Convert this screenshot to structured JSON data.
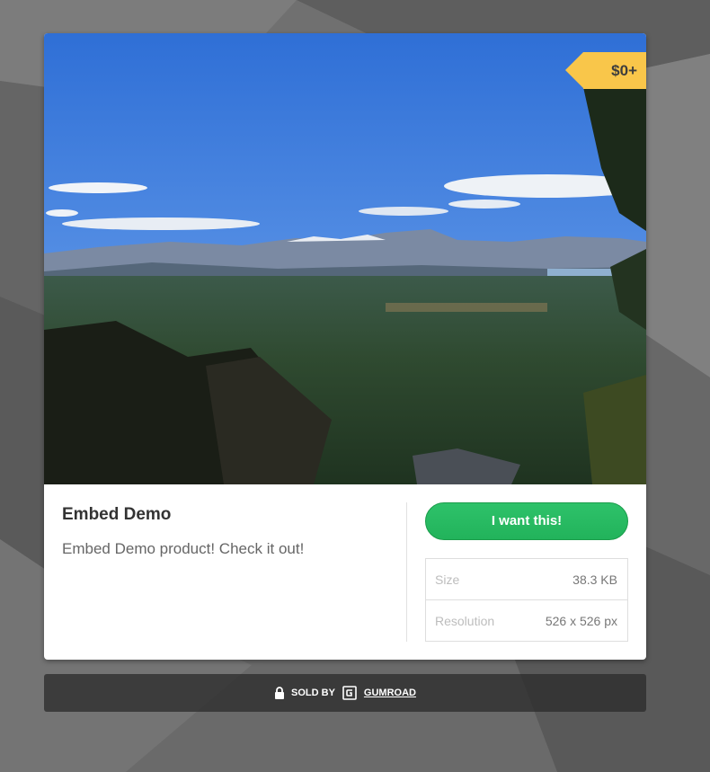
{
  "product": {
    "price": "$0+",
    "title": "Embed Demo",
    "description": "Embed Demo product! Check it out!",
    "buy_label": "I want this!",
    "attributes": [
      {
        "label": "Size",
        "value": "38.3 KB"
      },
      {
        "label": "Resolution",
        "value": "526 x 526 px"
      }
    ]
  },
  "footer": {
    "sold_by": "SOLD BY",
    "brand": "GUMROAD"
  },
  "icons": {
    "lock": "lock-icon",
    "brand": "gumroad-logo-icon"
  },
  "colors": {
    "accent_green": "#22b35b",
    "price_tag": "#f9c64a",
    "background": "#6e6e6e"
  }
}
